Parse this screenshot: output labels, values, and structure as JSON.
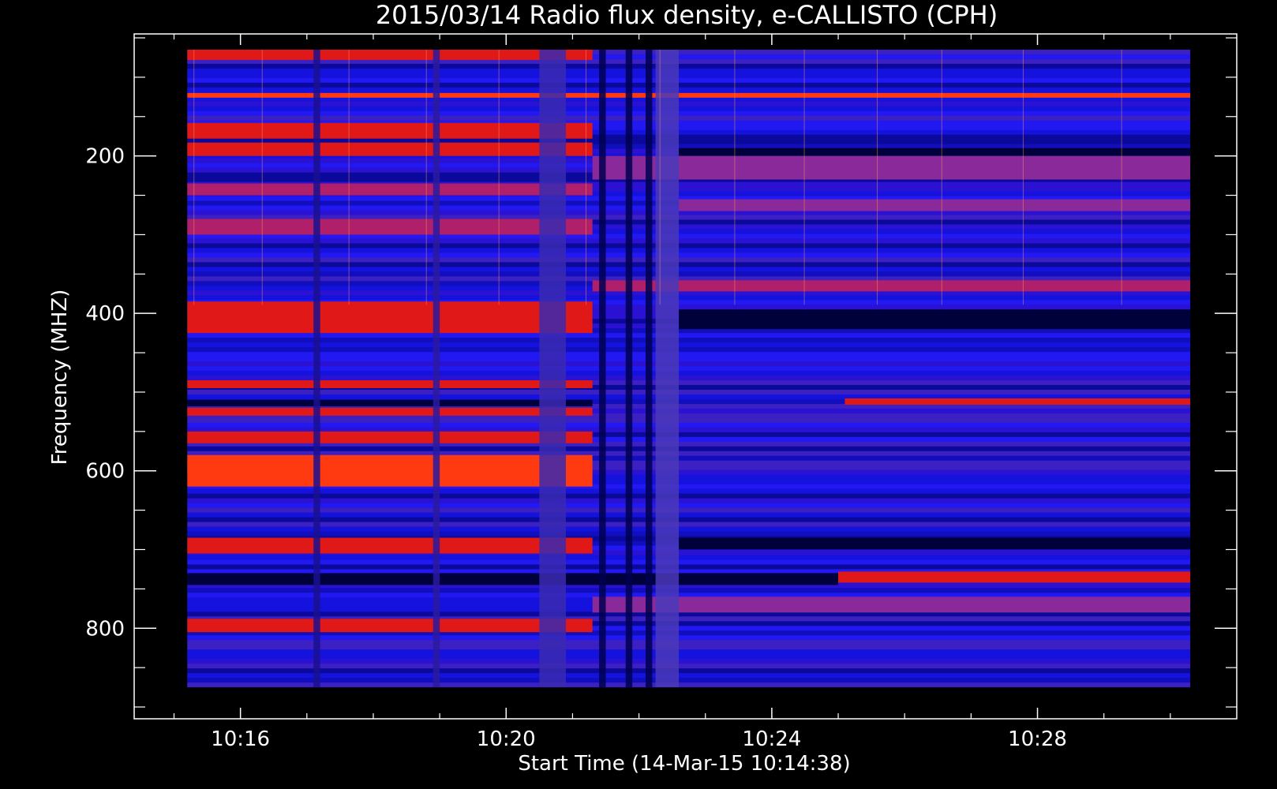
{
  "chart_data": {
    "type": "heatmap",
    "title": "2015/03/14  Radio flux density, e-CALLISTO (CPH)",
    "xlabel": "Start Time (14-Mar-15 10:14:38)",
    "ylabel": "Frequency (MHZ)",
    "x_tick_labels": [
      "10:16",
      "10:20",
      "10:24",
      "10:28"
    ],
    "x_ticks_min": [
      16,
      20,
      24,
      28
    ],
    "x_range_min": [
      14.4,
      31.0
    ],
    "x_data_range_min": [
      15.2,
      30.3
    ],
    "y_tick_labels": [
      "200",
      "400",
      "600",
      "800"
    ],
    "y_ticks": [
      200,
      400,
      600,
      800
    ],
    "y_range": [
      45,
      915
    ],
    "y_data_range": [
      65,
      875
    ],
    "y_inverted": true,
    "colormap": [
      "#000000",
      "#0000ff",
      "#7a3aa0",
      "#ff0000",
      "#ffd000"
    ],
    "series": [
      {
        "name": "",
        "values": []
      }
    ],
    "bright_bands_mhz": [
      {
        "f0": 65,
        "f1": 78,
        "t0": 15.2,
        "t1": 21.3,
        "level": 0.8
      },
      {
        "f0": 120,
        "f1": 126,
        "t0": 15.2,
        "t1": 30.3,
        "level": 0.9
      },
      {
        "f0": 158,
        "f1": 178,
        "t0": 15.2,
        "t1": 21.3,
        "level": 0.85
      },
      {
        "f0": 183,
        "f1": 200,
        "t0": 15.2,
        "t1": 21.3,
        "level": 0.8
      },
      {
        "f0": 235,
        "f1": 250,
        "t0": 15.2,
        "t1": 21.3,
        "level": 0.7
      },
      {
        "f0": 280,
        "f1": 300,
        "t0": 15.2,
        "t1": 21.3,
        "level": 0.7
      },
      {
        "f0": 385,
        "f1": 425,
        "t0": 15.2,
        "t1": 21.3,
        "level": 0.85
      },
      {
        "f0": 485,
        "f1": 495,
        "t0": 15.2,
        "t1": 21.3,
        "level": 0.75
      },
      {
        "f0": 520,
        "f1": 530,
        "t0": 15.2,
        "t1": 21.3,
        "level": 0.75
      },
      {
        "f0": 550,
        "f1": 565,
        "t0": 15.2,
        "t1": 21.3,
        "level": 0.8
      },
      {
        "f0": 580,
        "f1": 620,
        "t0": 15.2,
        "t1": 21.3,
        "level": 0.9
      },
      {
        "f0": 685,
        "f1": 705,
        "t0": 15.2,
        "t1": 21.3,
        "level": 0.85
      },
      {
        "f0": 788,
        "f1": 805,
        "t0": 15.2,
        "t1": 21.3,
        "level": 0.8
      },
      {
        "f0": 200,
        "f1": 230,
        "t0": 21.3,
        "t1": 30.3,
        "level": 0.55
      },
      {
        "f0": 255,
        "f1": 270,
        "t0": 22.6,
        "t1": 30.3,
        "level": 0.55
      },
      {
        "f0": 358,
        "f1": 372,
        "t0": 21.3,
        "t1": 30.3,
        "level": 0.6
      },
      {
        "f0": 508,
        "f1": 516,
        "t0": 25.1,
        "t1": 30.3,
        "level": 0.75
      },
      {
        "f0": 728,
        "f1": 742,
        "t0": 25.0,
        "t1": 30.3,
        "level": 0.85
      },
      {
        "f0": 760,
        "f1": 780,
        "t0": 21.3,
        "t1": 30.3,
        "level": 0.5
      }
    ],
    "dark_bands_mhz": [
      {
        "f0": 730,
        "f1": 745,
        "t0": 15.2,
        "t1": 25.0
      },
      {
        "f0": 510,
        "f1": 518,
        "t0": 15.2,
        "t1": 21.3
      },
      {
        "f0": 190,
        "f1": 200,
        "t0": 22.6,
        "t1": 30.3
      },
      {
        "f0": 395,
        "f1": 420,
        "t0": 22.6,
        "t1": 30.3
      },
      {
        "f0": 685,
        "f1": 700,
        "t0": 22.6,
        "t1": 30.3
      }
    ]
  }
}
